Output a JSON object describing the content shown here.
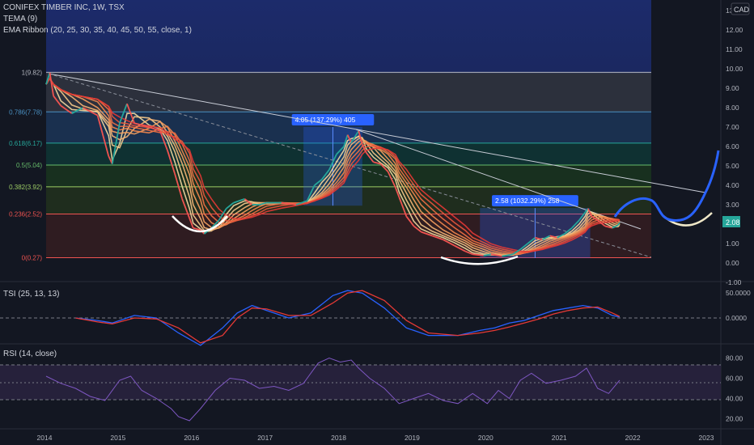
{
  "header": {
    "symbol_line": "CONIFEX TIMBER INC, 1W, TSX",
    "indicator_1": "TEMA (9)",
    "indicator_2": "EMA Ribbon (20, 25, 30, 35, 40, 45, 50, 55, close, 1)",
    "currency_badge": "CAD"
  },
  "colors": {
    "background": "#131722",
    "price_up": "#26a69a",
    "price_down": "#ef5350",
    "ribbon_fast": "#f3d9a0",
    "ribbon_slow": "#e53935",
    "projection": "#2962ff",
    "tsi_blue": "#2962ff",
    "tsi_red": "#e53935",
    "rsi_line": "#7e57c2"
  },
  "chart_data": [
    {
      "type": "candlestick",
      "title": "CONIFEX TIMBER INC, 1W, TSX",
      "x_ticks": [
        "2014",
        "2015",
        "2016",
        "2017",
        "2018",
        "2019",
        "2020",
        "2021",
        "2022",
        "2023"
      ],
      "y_ticks": [
        "-1.00",
        "0.00",
        "1.00",
        "2.00",
        "3.00",
        "4.00",
        "5.00",
        "6.00",
        "7.00",
        "8.00",
        "9.00",
        "10.00",
        "11.00",
        "12.00",
        "13"
      ],
      "ylim": [
        -1,
        13
      ],
      "last_price": "2.08",
      "price_series": [
        [
          2014.0,
          9.2
        ],
        [
          2014.05,
          9.8
        ],
        [
          2014.1,
          8.6
        ],
        [
          2014.2,
          8.1
        ],
        [
          2014.35,
          7.7
        ],
        [
          2014.5,
          8.0
        ],
        [
          2014.7,
          7.6
        ],
        [
          2014.85,
          5.5
        ],
        [
          2014.9,
          5.1
        ],
        [
          2015.0,
          7.2
        ],
        [
          2015.1,
          8.2
        ],
        [
          2015.2,
          7.2
        ],
        [
          2015.4,
          7.0
        ],
        [
          2015.55,
          6.8
        ],
        [
          2015.65,
          5.8
        ],
        [
          2015.75,
          4.6
        ],
        [
          2015.85,
          3.3
        ],
        [
          2015.95,
          2.3
        ],
        [
          2016.0,
          1.8
        ],
        [
          2016.1,
          1.7
        ],
        [
          2016.15,
          1.5
        ],
        [
          2016.25,
          1.8
        ],
        [
          2016.35,
          2.2
        ],
        [
          2016.45,
          2.8
        ],
        [
          2016.55,
          3.1
        ],
        [
          2016.7,
          3.3
        ],
        [
          2016.8,
          3.0
        ],
        [
          2016.9,
          3.0
        ],
        [
          2017.0,
          3.1
        ],
        [
          2017.2,
          3.1
        ],
        [
          2017.4,
          3.0
        ],
        [
          2017.55,
          3.2
        ],
        [
          2017.65,
          4.0
        ],
        [
          2017.75,
          4.3
        ],
        [
          2017.85,
          4.8
        ],
        [
          2017.95,
          5.6
        ],
        [
          2018.05,
          6.0
        ],
        [
          2018.1,
          6.6
        ],
        [
          2018.15,
          6.2
        ],
        [
          2018.25,
          6.8
        ],
        [
          2018.3,
          6.1
        ],
        [
          2018.35,
          5.7
        ],
        [
          2018.45,
          5.2
        ],
        [
          2018.55,
          5.1
        ],
        [
          2018.65,
          4.7
        ],
        [
          2018.75,
          3.9
        ],
        [
          2018.8,
          3.4
        ],
        [
          2018.9,
          2.4
        ],
        [
          2019.0,
          1.9
        ],
        [
          2019.1,
          1.6
        ],
        [
          2019.25,
          1.4
        ],
        [
          2019.4,
          1.2
        ],
        [
          2019.55,
          0.9
        ],
        [
          2019.7,
          0.6
        ],
        [
          2019.8,
          0.45
        ],
        [
          2019.95,
          0.38
        ],
        [
          2020.05,
          0.45
        ],
        [
          2020.2,
          0.35
        ],
        [
          2020.35,
          0.45
        ],
        [
          2020.45,
          0.7
        ],
        [
          2020.55,
          1.0
        ],
        [
          2020.65,
          1.3
        ],
        [
          2020.75,
          1.2
        ],
        [
          2020.85,
          1.4
        ],
        [
          2020.95,
          1.3
        ],
        [
          2021.05,
          1.5
        ],
        [
          2021.15,
          1.8
        ],
        [
          2021.25,
          2.2
        ],
        [
          2021.33,
          2.6
        ],
        [
          2021.37,
          2.8
        ],
        [
          2021.42,
          2.4
        ],
        [
          2021.5,
          2.2
        ],
        [
          2021.6,
          1.9
        ],
        [
          2021.7,
          1.8
        ],
        [
          2021.78,
          1.95
        ],
        [
          2021.8,
          2.08
        ]
      ],
      "fib_levels": [
        {
          "label": "1(9.82)",
          "value": 9.82,
          "fill": "#363a45"
        },
        {
          "label": "0.786(7.78)",
          "value": 7.78,
          "fill": "#1e3a5f"
        },
        {
          "label": "0.618(6.17)",
          "value": 6.17,
          "fill": "#0f3b38"
        },
        {
          "label": "0.5(5.04)",
          "value": 5.04,
          "fill": "#1b3a1f"
        },
        {
          "label": "0.382(3.92)",
          "value": 3.92,
          "fill": "#24361d"
        },
        {
          "label": "0.236(2.52)",
          "value": 2.52,
          "fill": "#3a1f22"
        },
        {
          "label": "0(0.27)",
          "value": 0.27,
          "fill": "#3a1f22"
        }
      ],
      "measurements": [
        {
          "label": "4.05 (137.29%) 405",
          "x0": 2017.5,
          "x1": 2018.3,
          "y0": 2.95,
          "y1": 7.0
        },
        {
          "label": "2.58 (1032.29%) 258",
          "x0": 2019.9,
          "x1": 2021.4,
          "y0": 0.25,
          "y1": 2.83
        }
      ]
    },
    {
      "type": "line",
      "title": "TSI (25, 13, 13)",
      "y_ticks": [
        "50.0000",
        "0.0000"
      ],
      "ylim": [
        -60,
        60
      ],
      "series": [
        {
          "values": [
            [
              2014.4,
              0
            ],
            [
              2014.7,
              -5
            ],
            [
              2014.9,
              -10
            ],
            [
              2015.2,
              5
            ],
            [
              2015.5,
              0
            ],
            [
              2015.8,
              -30
            ],
            [
              2016.1,
              -55
            ],
            [
              2016.4,
              -20
            ],
            [
              2016.6,
              10
            ],
            [
              2016.8,
              25
            ],
            [
              2017.0,
              15
            ],
            [
              2017.3,
              0
            ],
            [
              2017.6,
              10
            ],
            [
              2017.9,
              45
            ],
            [
              2018.1,
              55
            ],
            [
              2018.3,
              50
            ],
            [
              2018.6,
              20
            ],
            [
              2018.9,
              -20
            ],
            [
              2019.2,
              -35
            ],
            [
              2019.6,
              -35
            ],
            [
              2019.9,
              -25
            ],
            [
              2020.1,
              -20
            ],
            [
              2020.3,
              -10
            ],
            [
              2020.5,
              -5
            ],
            [
              2020.7,
              5
            ],
            [
              2020.9,
              15
            ],
            [
              2021.1,
              20
            ],
            [
              2021.3,
              25
            ],
            [
              2021.5,
              20
            ],
            [
              2021.7,
              5
            ],
            [
              2021.8,
              2
            ]
          ]
        },
        {
          "values": [
            [
              2014.4,
              0
            ],
            [
              2014.7,
              -8
            ],
            [
              2014.9,
              -12
            ],
            [
              2015.2,
              0
            ],
            [
              2015.5,
              -2
            ],
            [
              2015.8,
              -20
            ],
            [
              2016.1,
              -50
            ],
            [
              2016.4,
              -35
            ],
            [
              2016.6,
              0
            ],
            [
              2016.8,
              20
            ],
            [
              2017.0,
              18
            ],
            [
              2017.3,
              5
            ],
            [
              2017.6,
              5
            ],
            [
              2017.9,
              30
            ],
            [
              2018.1,
              50
            ],
            [
              2018.3,
              55
            ],
            [
              2018.6,
              35
            ],
            [
              2018.9,
              -5
            ],
            [
              2019.2,
              -30
            ],
            [
              2019.6,
              -35
            ],
            [
              2019.9,
              -30
            ],
            [
              2020.1,
              -25
            ],
            [
              2020.3,
              -18
            ],
            [
              2020.5,
              -10
            ],
            [
              2020.7,
              -2
            ],
            [
              2020.9,
              8
            ],
            [
              2021.1,
              15
            ],
            [
              2021.3,
              20
            ],
            [
              2021.5,
              22
            ],
            [
              2021.7,
              10
            ],
            [
              2021.8,
              3
            ]
          ]
        }
      ]
    },
    {
      "type": "line",
      "title": "RSI (14, close)",
      "y_ticks": [
        "80.00",
        "60.00",
        "40.00",
        "20.00"
      ],
      "ylim": [
        10,
        90
      ],
      "series": [
        {
          "values": [
            [
              2014.0,
              62
            ],
            [
              2014.2,
              55
            ],
            [
              2014.4,
              50
            ],
            [
              2014.6,
              42
            ],
            [
              2014.8,
              38
            ],
            [
              2015.0,
              58
            ],
            [
              2015.15,
              62
            ],
            [
              2015.3,
              48
            ],
            [
              2015.5,
              40
            ],
            [
              2015.7,
              30
            ],
            [
              2015.8,
              22
            ],
            [
              2015.95,
              18
            ],
            [
              2016.1,
              30
            ],
            [
              2016.3,
              48
            ],
            [
              2016.5,
              60
            ],
            [
              2016.7,
              58
            ],
            [
              2016.9,
              50
            ],
            [
              2017.1,
              52
            ],
            [
              2017.3,
              48
            ],
            [
              2017.5,
              55
            ],
            [
              2017.7,
              75
            ],
            [
              2017.85,
              80
            ],
            [
              2018.0,
              76
            ],
            [
              2018.15,
              78
            ],
            [
              2018.25,
              70
            ],
            [
              2018.4,
              60
            ],
            [
              2018.6,
              50
            ],
            [
              2018.8,
              35
            ],
            [
              2019.0,
              40
            ],
            [
              2019.2,
              45
            ],
            [
              2019.4,
              38
            ],
            [
              2019.6,
              35
            ],
            [
              2019.8,
              45
            ],
            [
              2020.0,
              35
            ],
            [
              2020.15,
              48
            ],
            [
              2020.3,
              40
            ],
            [
              2020.45,
              58
            ],
            [
              2020.6,
              65
            ],
            [
              2020.8,
              55
            ],
            [
              2021.0,
              58
            ],
            [
              2021.2,
              62
            ],
            [
              2021.35,
              70
            ],
            [
              2021.5,
              50
            ],
            [
              2021.65,
              45
            ],
            [
              2021.8,
              58
            ]
          ]
        }
      ]
    }
  ]
}
